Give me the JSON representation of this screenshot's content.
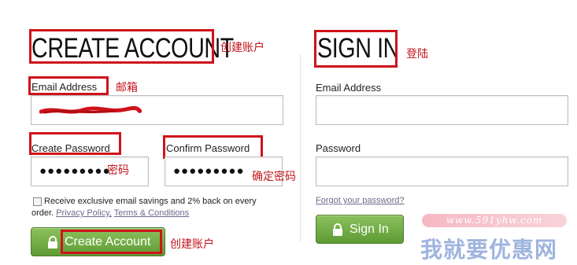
{
  "create": {
    "heading": "CREATE ACCOUNT",
    "heading_annotation": "创建账户",
    "email_label": "Email Address",
    "email_annotation": "邮箱",
    "password_label": "Create Password",
    "password_value": "●●●●●●●●●",
    "password_annotation": "密码",
    "confirm_label": "Confirm Password",
    "confirm_value": "●●●●●●●●●",
    "confirm_annotation": "确定密码",
    "optin_text": "Receive exclusive email savings and 2% back on every",
    "optin_text_2": "order.",
    "privacy_link": "Privacy Policy,",
    "terms_link": "Terms & Conditions",
    "button_label": "Create Account",
    "button_annotation": "创建账户"
  },
  "signin": {
    "heading": "SIGN IN",
    "heading_annotation": "登陆",
    "email_label": "Email Address",
    "password_label": "Password",
    "forgot_link": "Forgot your password?",
    "button_label": "Sign In"
  },
  "watermark": {
    "url": "www.591yhw.com",
    "brand": "我就要优惠网"
  },
  "colors": {
    "annotation_red": "#c3141c",
    "button_green": "#6aa73d",
    "link": "#6b6b8c"
  }
}
